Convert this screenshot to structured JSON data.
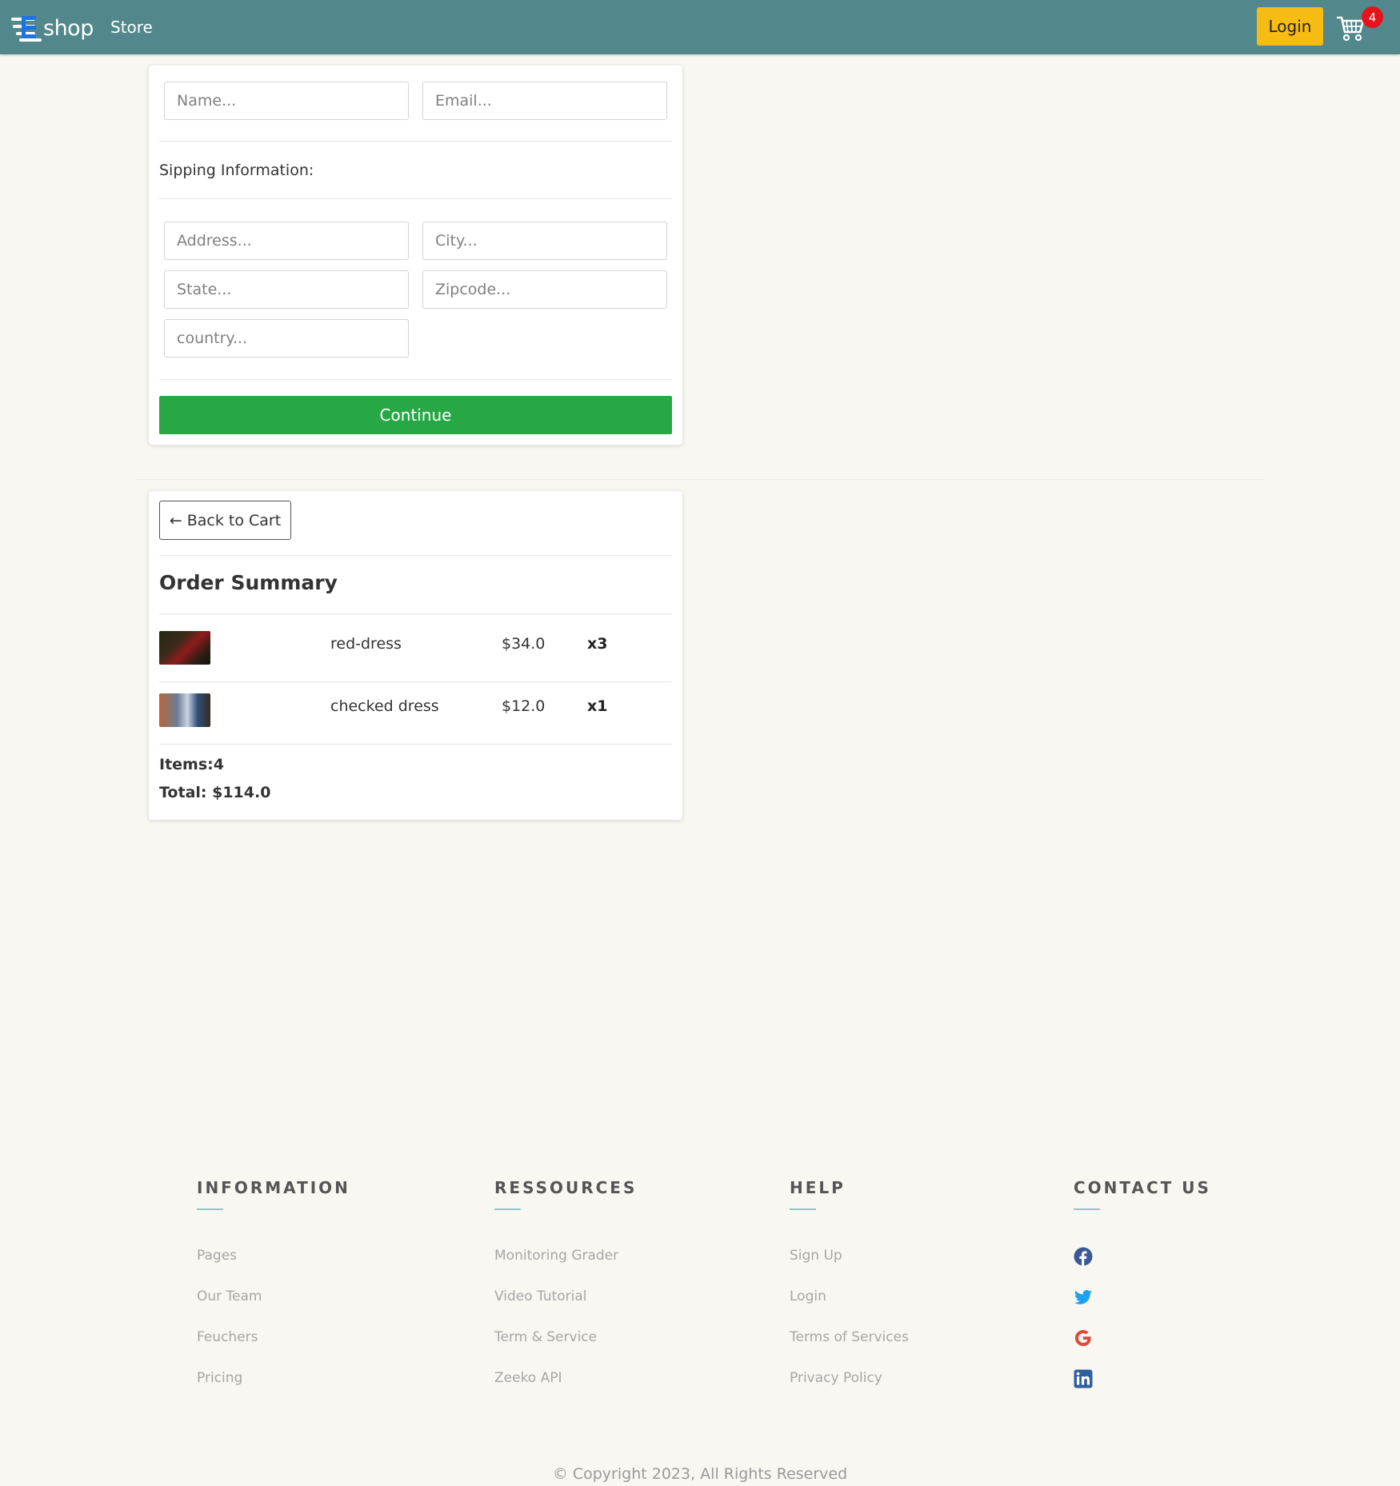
{
  "navbar": {
    "brand": "shop",
    "store_link": "Store",
    "login_label": "Login",
    "cart_count": "4",
    "bg_color": "#52888b",
    "login_color": "#f6bc13",
    "badge_color": "#e5141a"
  },
  "form": {
    "name_placeholder": "Name...",
    "email_placeholder": "Email...",
    "shipping_label": "Sipping Information:",
    "address_placeholder": "Address...",
    "city_placeholder": "City...",
    "state_placeholder": "State...",
    "zip_placeholder": "Zipcode...",
    "country_placeholder": "country...",
    "continue_label": "Continue",
    "continue_color": "#28a745"
  },
  "summary": {
    "back_label": "← Back to Cart",
    "title": "Order Summary",
    "items": [
      {
        "name": "red-dress",
        "price": "$34.0",
        "qty": "x3"
      },
      {
        "name": "checked dress",
        "price": "$12.0",
        "qty": "x1"
      }
    ],
    "items_count": "Items:4",
    "total": "Total: $114.0"
  },
  "footer": {
    "columns": [
      {
        "title": "INFORMATION",
        "links": [
          "Pages",
          "Our Team",
          "Feuchers",
          "Pricing"
        ]
      },
      {
        "title": "RESSOURCES",
        "links": [
          "Monitoring Grader",
          "Video Tutorial",
          "Term & Service",
          "Zeeko API"
        ]
      },
      {
        "title": "HELP",
        "links": [
          "Sign Up",
          "Login",
          "Terms of Services",
          "Privacy Policy"
        ]
      },
      {
        "title": "CONTACT US",
        "icons": [
          "facebook-icon",
          "twitter-icon",
          "google-icon",
          "linkedin-icon"
        ]
      }
    ],
    "copyright": "© Copyright 2023, All Rights Reserved"
  }
}
